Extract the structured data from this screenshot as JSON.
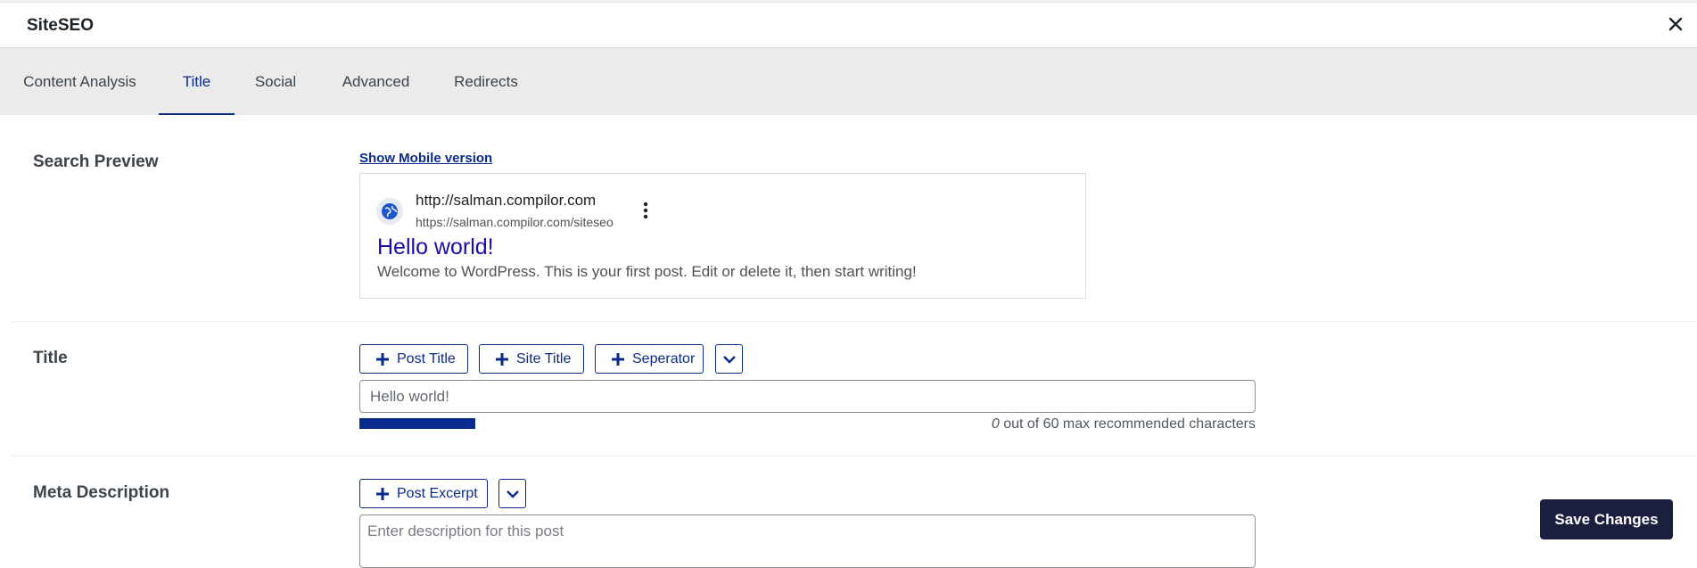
{
  "header": {
    "title": "SiteSEO",
    "close_icon": "close-icon"
  },
  "tabs": [
    {
      "label": "Content Analysis",
      "active": false
    },
    {
      "label": "Title",
      "active": true
    },
    {
      "label": "Social",
      "active": false
    },
    {
      "label": "Advanced",
      "active": false
    },
    {
      "label": "Redirects",
      "active": false
    }
  ],
  "search_preview": {
    "label": "Search Preview",
    "toggle_link": "Show Mobile version",
    "site": "http://salman.compilor.com",
    "url": "https://salman.compilor.com/siteseo",
    "title": "Hello world!",
    "description": "Welcome to WordPress. This is your first post. Edit or delete it, then start writing!"
  },
  "title_section": {
    "label": "Title",
    "buttons": [
      "Post Title",
      "Site Title",
      "Seperator"
    ],
    "input_value": "Hello world!",
    "counter_count": "0",
    "counter_text": " out of 60 max recommended characters"
  },
  "meta_description": {
    "label": "Meta Description",
    "buttons": [
      "Post Excerpt"
    ],
    "placeholder": "Enter description for this post"
  },
  "save_button": "Save Changes",
  "colors": {
    "accent": "#0a2a8c",
    "link_title": "#1a0dab",
    "save_bg": "#1a1f3d",
    "tab_bar": "#ebebeb"
  }
}
